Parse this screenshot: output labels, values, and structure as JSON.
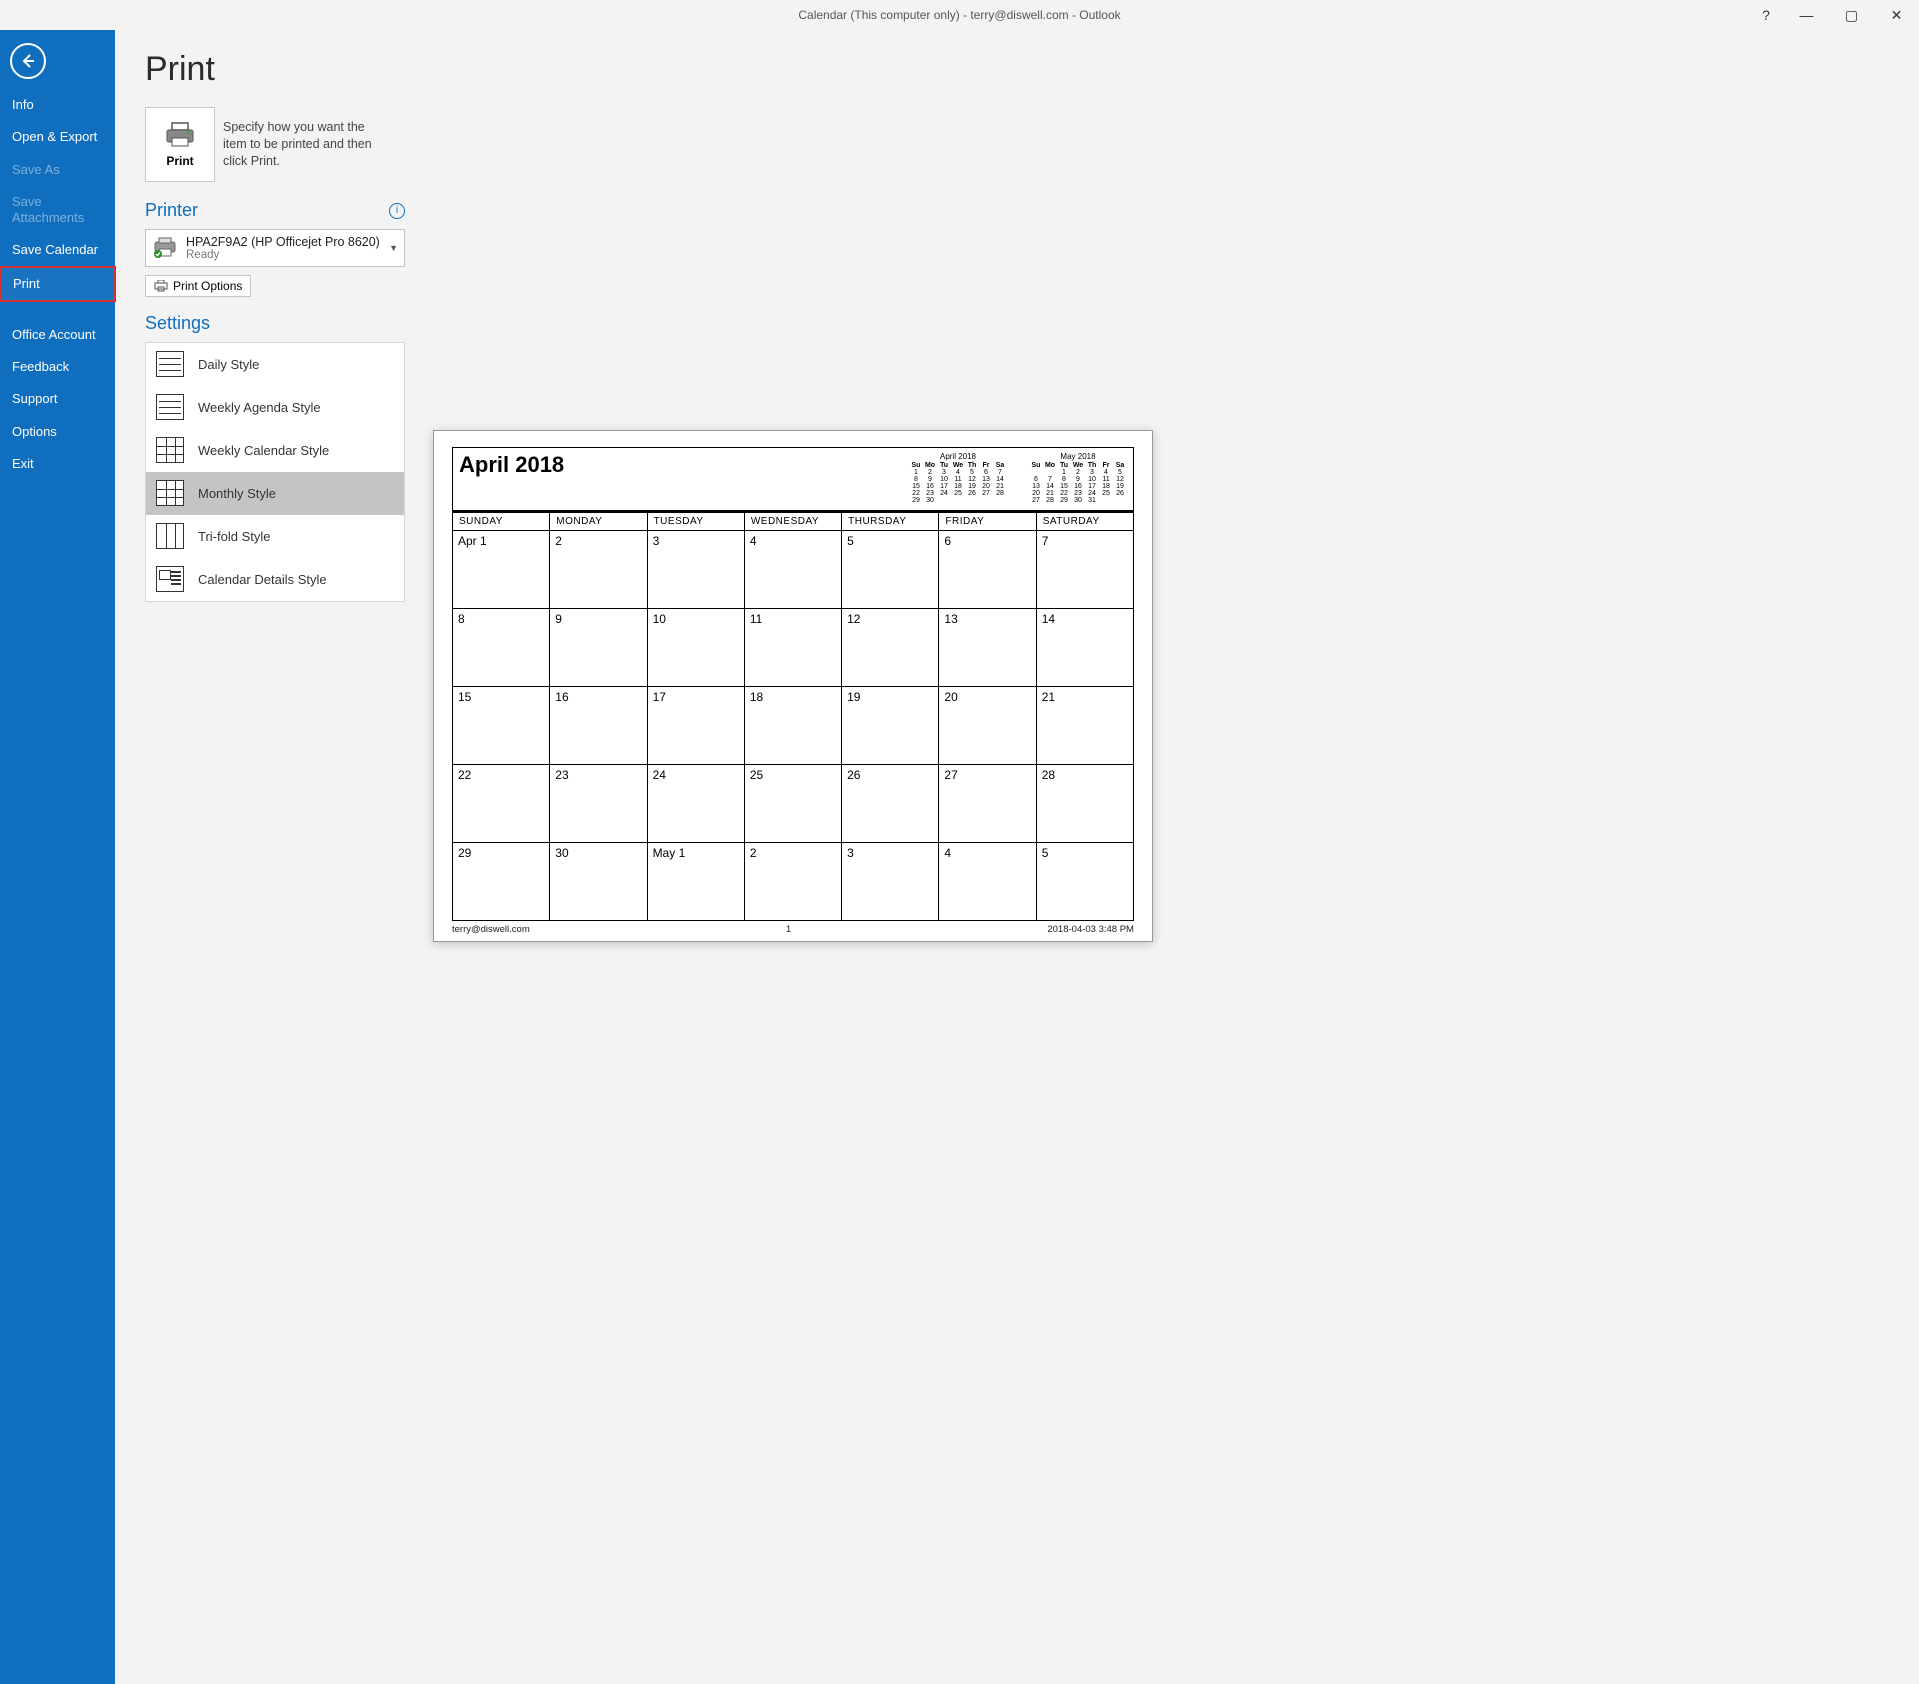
{
  "window": {
    "title": "Calendar (This computer only) - terry@diswell.com  -  Outlook"
  },
  "sidebar": {
    "items": [
      {
        "label": "Info",
        "disabled": false
      },
      {
        "label": "Open & Export",
        "disabled": false
      },
      {
        "label": "Save As",
        "disabled": true
      },
      {
        "label": "Save Attachments",
        "disabled": true
      },
      {
        "label": "Save Calendar",
        "disabled": false
      },
      {
        "label": "Print",
        "disabled": false,
        "selected": true
      },
      {
        "label": "Office Account",
        "disabled": false,
        "spaced": true
      },
      {
        "label": "Feedback",
        "disabled": false
      },
      {
        "label": "Support",
        "disabled": false
      },
      {
        "label": "Options",
        "disabled": false
      },
      {
        "label": "Exit",
        "disabled": false
      }
    ]
  },
  "page": {
    "title": "Print",
    "print_tile": "Print",
    "description": "Specify how you want the item to be printed and then click Print."
  },
  "printer": {
    "heading": "Printer",
    "name": "HPA2F9A2 (HP Officejet Pro 8620)",
    "status": "Ready",
    "options_btn": "Print Options"
  },
  "settings": {
    "heading": "Settings",
    "styles": [
      {
        "label": "Daily Style"
      },
      {
        "label": "Weekly Agenda Style"
      },
      {
        "label": "Weekly Calendar Style"
      },
      {
        "label": "Monthly Style",
        "selected": true
      },
      {
        "label": "Tri-fold Style"
      },
      {
        "label": "Calendar Details Style"
      }
    ]
  },
  "preview": {
    "month_title": "April 2018",
    "dow": [
      "SUNDAY",
      "MONDAY",
      "TUESDAY",
      "WEDNESDAY",
      "THURSDAY",
      "FRIDAY",
      "SATURDAY"
    ],
    "dow_short": [
      "Su",
      "Mo",
      "Tu",
      "We",
      "Th",
      "Fr",
      "Sa"
    ],
    "weeks": [
      [
        "Apr 1",
        "2",
        "3",
        "4",
        "5",
        "6",
        "7"
      ],
      [
        "8",
        "9",
        "10",
        "11",
        "12",
        "13",
        "14"
      ],
      [
        "15",
        "16",
        "17",
        "18",
        "19",
        "20",
        "21"
      ],
      [
        "22",
        "23",
        "24",
        "25",
        "26",
        "27",
        "28"
      ],
      [
        "29",
        "30",
        "May 1",
        "2",
        "3",
        "4",
        "5"
      ]
    ],
    "mini": [
      {
        "name": "April 2018",
        "rows": [
          [
            "1",
            "2",
            "3",
            "4",
            "5",
            "6",
            "7"
          ],
          [
            "8",
            "9",
            "10",
            "11",
            "12",
            "13",
            "14"
          ],
          [
            "15",
            "16",
            "17",
            "18",
            "19",
            "20",
            "21"
          ],
          [
            "22",
            "23",
            "24",
            "25",
            "26",
            "27",
            "28"
          ],
          [
            "29",
            "30",
            "",
            "",
            "",
            "",
            ""
          ]
        ]
      },
      {
        "name": "May 2018",
        "rows": [
          [
            "",
            "",
            "1",
            "2",
            "3",
            "4",
            "5"
          ],
          [
            "6",
            "7",
            "8",
            "9",
            "10",
            "11",
            "12"
          ],
          [
            "13",
            "14",
            "15",
            "16",
            "17",
            "18",
            "19"
          ],
          [
            "20",
            "21",
            "22",
            "23",
            "24",
            "25",
            "26"
          ],
          [
            "27",
            "28",
            "29",
            "30",
            "31",
            "",
            ""
          ]
        ]
      }
    ],
    "footer_left": "terry@diswell.com",
    "footer_center": "1",
    "footer_right": "2018-04-03 3:48 PM"
  }
}
